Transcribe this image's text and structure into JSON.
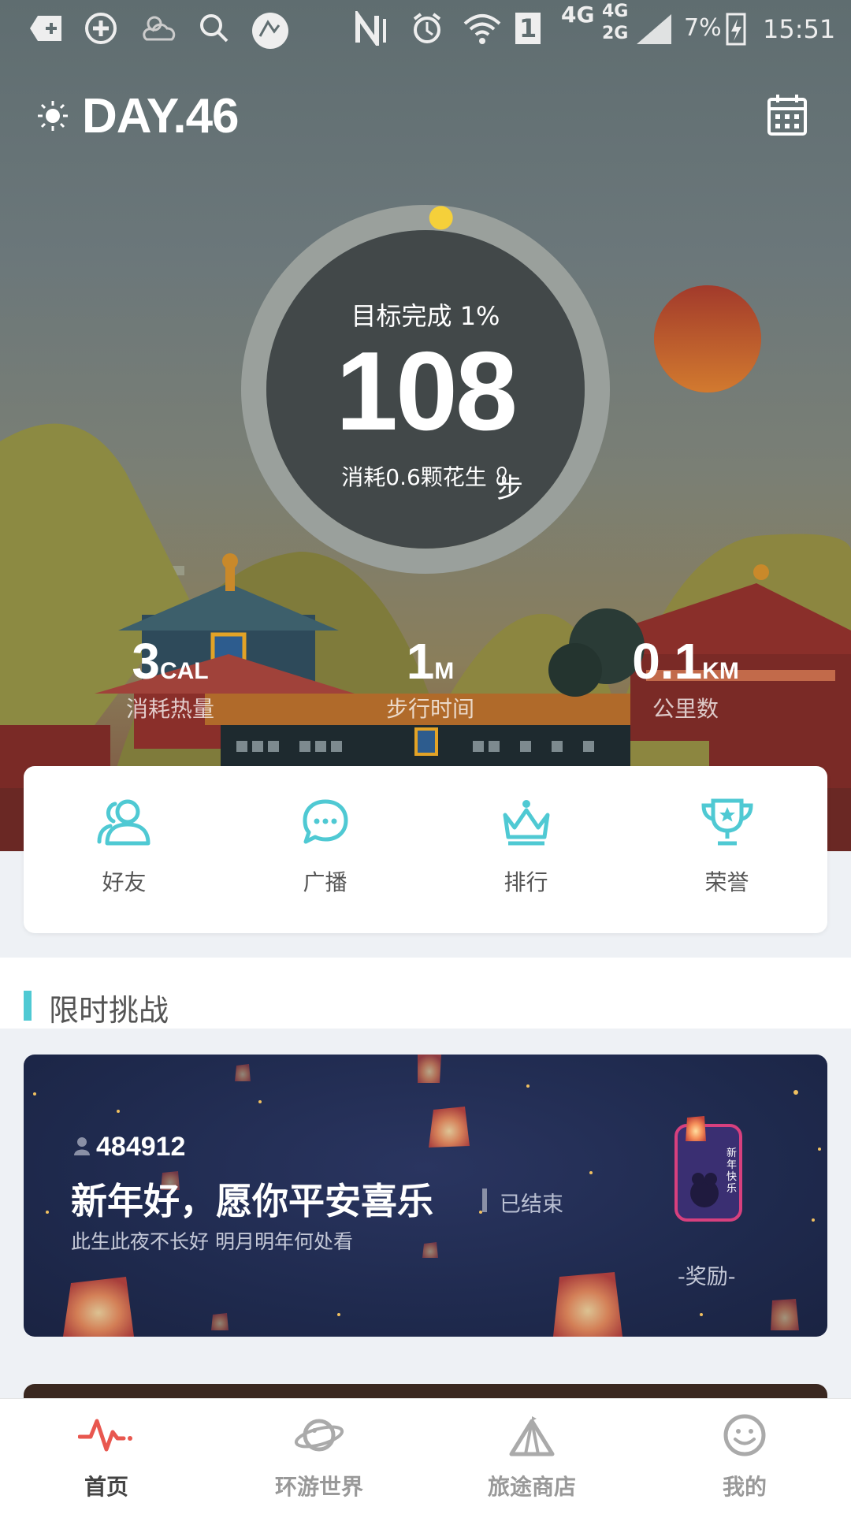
{
  "status_bar": {
    "network_1": "4G",
    "network_2": "4G",
    "network_3": "2G",
    "sim": "1",
    "battery": "7%",
    "time": "15:51"
  },
  "header": {
    "day_label": "DAY.46",
    "weather_icon": "sun-icon",
    "calendar_icon": "calendar-icon"
  },
  "progress": {
    "goal_text": "目标完成 1%",
    "goal_fraction": 0.01,
    "steps": "108",
    "steps_unit": "步",
    "peanut_text": "消耗0.6颗花生"
  },
  "stats": [
    {
      "value": "3",
      "unit": "CAL",
      "label": "消耗热量"
    },
    {
      "value": "1",
      "unit": "M",
      "label": "步行时间"
    },
    {
      "value": "0.1",
      "unit": "KM",
      "label": "公里数"
    }
  ],
  "quick_actions": [
    {
      "label": "好友",
      "icon": "friends-icon"
    },
    {
      "label": "广播",
      "icon": "broadcast-icon"
    },
    {
      "label": "排行",
      "icon": "crown-icon"
    },
    {
      "label": "荣誉",
      "icon": "trophy-icon"
    }
  ],
  "section": {
    "title": "限时挑战"
  },
  "challenge": {
    "participants": "484912",
    "title": "新年好，愿你平安喜乐",
    "status": "已结束",
    "subtitle": "此生此夜不长好 明月明年何处看",
    "reward_label": "-奖励-",
    "badge_text": "新年快乐"
  },
  "bottom_nav": [
    {
      "label": "首页",
      "icon": "pulse-icon",
      "active": true
    },
    {
      "label": "环游世界",
      "icon": "planet-icon",
      "active": false
    },
    {
      "label": "旅途商店",
      "icon": "tent-icon",
      "active": false
    },
    {
      "label": "我的",
      "icon": "smiley-icon",
      "active": false
    }
  ],
  "colors": {
    "accent": "#4fc9d3",
    "active_nav": "#e8574f",
    "progress_dot": "#f5d03a"
  }
}
